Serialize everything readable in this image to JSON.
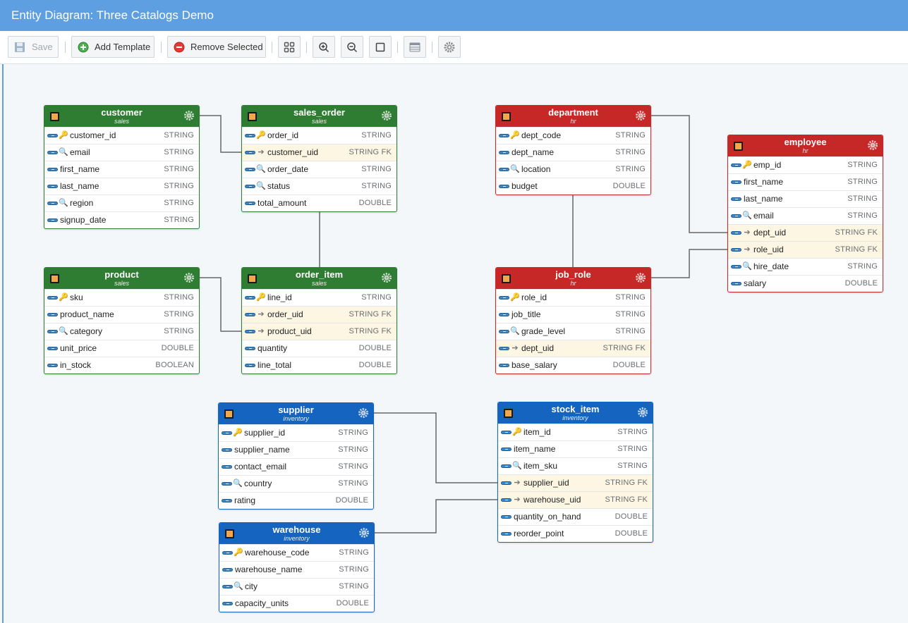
{
  "window": {
    "title": "Entity Diagram: Three Catalogs Demo"
  },
  "toolbar": {
    "save_label": "Save",
    "add_template_label": "Add Template",
    "remove_selected_label": "Remove Selected"
  },
  "entities": {
    "customer": {
      "name": "customer",
      "catalog": "sales",
      "fields": [
        {
          "name": "customer_id",
          "type": "STRING",
          "icon": "key"
        },
        {
          "name": "email",
          "type": "STRING",
          "icon": "index"
        },
        {
          "name": "first_name",
          "type": "STRING",
          "icon": ""
        },
        {
          "name": "last_name",
          "type": "STRING",
          "icon": ""
        },
        {
          "name": "region",
          "type": "STRING",
          "icon": "index"
        },
        {
          "name": "signup_date",
          "type": "STRING",
          "icon": ""
        }
      ]
    },
    "sales_order": {
      "name": "sales_order",
      "catalog": "sales",
      "fields": [
        {
          "name": "order_id",
          "type": "STRING",
          "icon": "key"
        },
        {
          "name": "customer_uid",
          "type": "STRING FK",
          "icon": "fk"
        },
        {
          "name": "order_date",
          "type": "STRING",
          "icon": "index"
        },
        {
          "name": "status",
          "type": "STRING",
          "icon": "index"
        },
        {
          "name": "total_amount",
          "type": "DOUBLE",
          "icon": ""
        }
      ]
    },
    "product": {
      "name": "product",
      "catalog": "sales",
      "fields": [
        {
          "name": "sku",
          "type": "STRING",
          "icon": "key"
        },
        {
          "name": "product_name",
          "type": "STRING",
          "icon": ""
        },
        {
          "name": "category",
          "type": "STRING",
          "icon": "index"
        },
        {
          "name": "unit_price",
          "type": "DOUBLE",
          "icon": ""
        },
        {
          "name": "in_stock",
          "type": "BOOLEAN",
          "icon": ""
        }
      ]
    },
    "order_item": {
      "name": "order_item",
      "catalog": "sales",
      "fields": [
        {
          "name": "line_id",
          "type": "STRING",
          "icon": "key"
        },
        {
          "name": "order_uid",
          "type": "STRING FK",
          "icon": "fk"
        },
        {
          "name": "product_uid",
          "type": "STRING FK",
          "icon": "fk"
        },
        {
          "name": "quantity",
          "type": "DOUBLE",
          "icon": ""
        },
        {
          "name": "line_total",
          "type": "DOUBLE",
          "icon": ""
        }
      ]
    },
    "department": {
      "name": "department",
      "catalog": "hr",
      "fields": [
        {
          "name": "dept_code",
          "type": "STRING",
          "icon": "key"
        },
        {
          "name": "dept_name",
          "type": "STRING",
          "icon": ""
        },
        {
          "name": "location",
          "type": "STRING",
          "icon": "index"
        },
        {
          "name": "budget",
          "type": "DOUBLE",
          "icon": ""
        }
      ]
    },
    "employee": {
      "name": "employee",
      "catalog": "hr",
      "fields": [
        {
          "name": "emp_id",
          "type": "STRING",
          "icon": "key"
        },
        {
          "name": "first_name",
          "type": "STRING",
          "icon": ""
        },
        {
          "name": "last_name",
          "type": "STRING",
          "icon": ""
        },
        {
          "name": "email",
          "type": "STRING",
          "icon": "index"
        },
        {
          "name": "dept_uid",
          "type": "STRING FK",
          "icon": "fk"
        },
        {
          "name": "role_uid",
          "type": "STRING FK",
          "icon": "fk"
        },
        {
          "name": "hire_date",
          "type": "STRING",
          "icon": "index"
        },
        {
          "name": "salary",
          "type": "DOUBLE",
          "icon": ""
        }
      ]
    },
    "job_role": {
      "name": "job_role",
      "catalog": "hr",
      "fields": [
        {
          "name": "role_id",
          "type": "STRING",
          "icon": "key"
        },
        {
          "name": "job_title",
          "type": "STRING",
          "icon": ""
        },
        {
          "name": "grade_level",
          "type": "STRING",
          "icon": "index"
        },
        {
          "name": "dept_uid",
          "type": "STRING FK",
          "icon": "fk"
        },
        {
          "name": "base_salary",
          "type": "DOUBLE",
          "icon": ""
        }
      ]
    },
    "supplier": {
      "name": "supplier",
      "catalog": "inventory",
      "fields": [
        {
          "name": "supplier_id",
          "type": "STRING",
          "icon": "key"
        },
        {
          "name": "supplier_name",
          "type": "STRING",
          "icon": ""
        },
        {
          "name": "contact_email",
          "type": "STRING",
          "icon": ""
        },
        {
          "name": "country",
          "type": "STRING",
          "icon": "index"
        },
        {
          "name": "rating",
          "type": "DOUBLE",
          "icon": ""
        }
      ]
    },
    "stock_item": {
      "name": "stock_item",
      "catalog": "inventory",
      "fields": [
        {
          "name": "item_id",
          "type": "STRING",
          "icon": "key"
        },
        {
          "name": "item_name",
          "type": "STRING",
          "icon": ""
        },
        {
          "name": "item_sku",
          "type": "STRING",
          "icon": "index"
        },
        {
          "name": "supplier_uid",
          "type": "STRING FK",
          "icon": "fk"
        },
        {
          "name": "warehouse_uid",
          "type": "STRING FK",
          "icon": "fk"
        },
        {
          "name": "quantity_on_hand",
          "type": "DOUBLE",
          "icon": ""
        },
        {
          "name": "reorder_point",
          "type": "DOUBLE",
          "icon": ""
        }
      ]
    },
    "warehouse": {
      "name": "warehouse",
      "catalog": "inventory",
      "fields": [
        {
          "name": "warehouse_code",
          "type": "STRING",
          "icon": "key"
        },
        {
          "name": "warehouse_name",
          "type": "STRING",
          "icon": ""
        },
        {
          "name": "city",
          "type": "STRING",
          "icon": "index"
        },
        {
          "name": "capacity_units",
          "type": "DOUBLE",
          "icon": ""
        }
      ]
    }
  },
  "colors": {
    "sales": "#2e7d32",
    "hr": "#c62828",
    "inventory": "#1565c0",
    "titlebar": "#5d9fe0",
    "fk_row": "#fdf6e3"
  }
}
